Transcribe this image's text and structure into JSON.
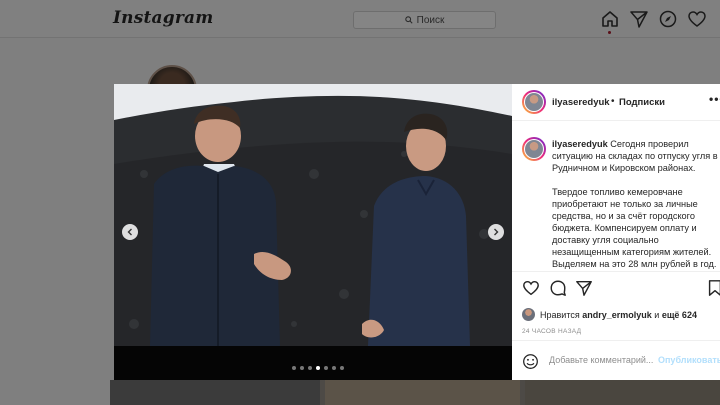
{
  "header": {
    "logo": "Instagram",
    "search_placeholder": "Поиск",
    "icons": [
      "home-icon",
      "direct-icon",
      "explore-icon",
      "heart-icon"
    ]
  },
  "post": {
    "username": "ilyaseredyuk",
    "separator": "•",
    "follow_label": "Подписки",
    "more_label": "•••",
    "caption_user": "ilyaseredyuk",
    "caption_p1": "Сегодня проверил ситуацию на складах по отпуску угля в Рудничном и Кировском районах.",
    "caption_p2": "Твердое топливо кемеровчане приобретают не только за личные средства, но и за счёт городского бюджета. Компенсируем оплату и доставку угля социально незащищенным категориям жителей. Выделяем на это 28 млн рублей в год.",
    "carousel": {
      "count": 7,
      "active": 4
    },
    "likes_prefix": "Нравится",
    "likes_user": "andry_ermolyuk",
    "likes_conj": "и",
    "likes_more": "ещё 624",
    "time": "24 ЧАСОВ НАЗАД",
    "comment_placeholder": "Добавьте комментарий...",
    "publish_label": "Опубликовать"
  },
  "colors": {
    "overlay": "#7f7f7f",
    "publish": "#b2dffc",
    "text": "#262626",
    "muted": "#8e8e8e"
  }
}
